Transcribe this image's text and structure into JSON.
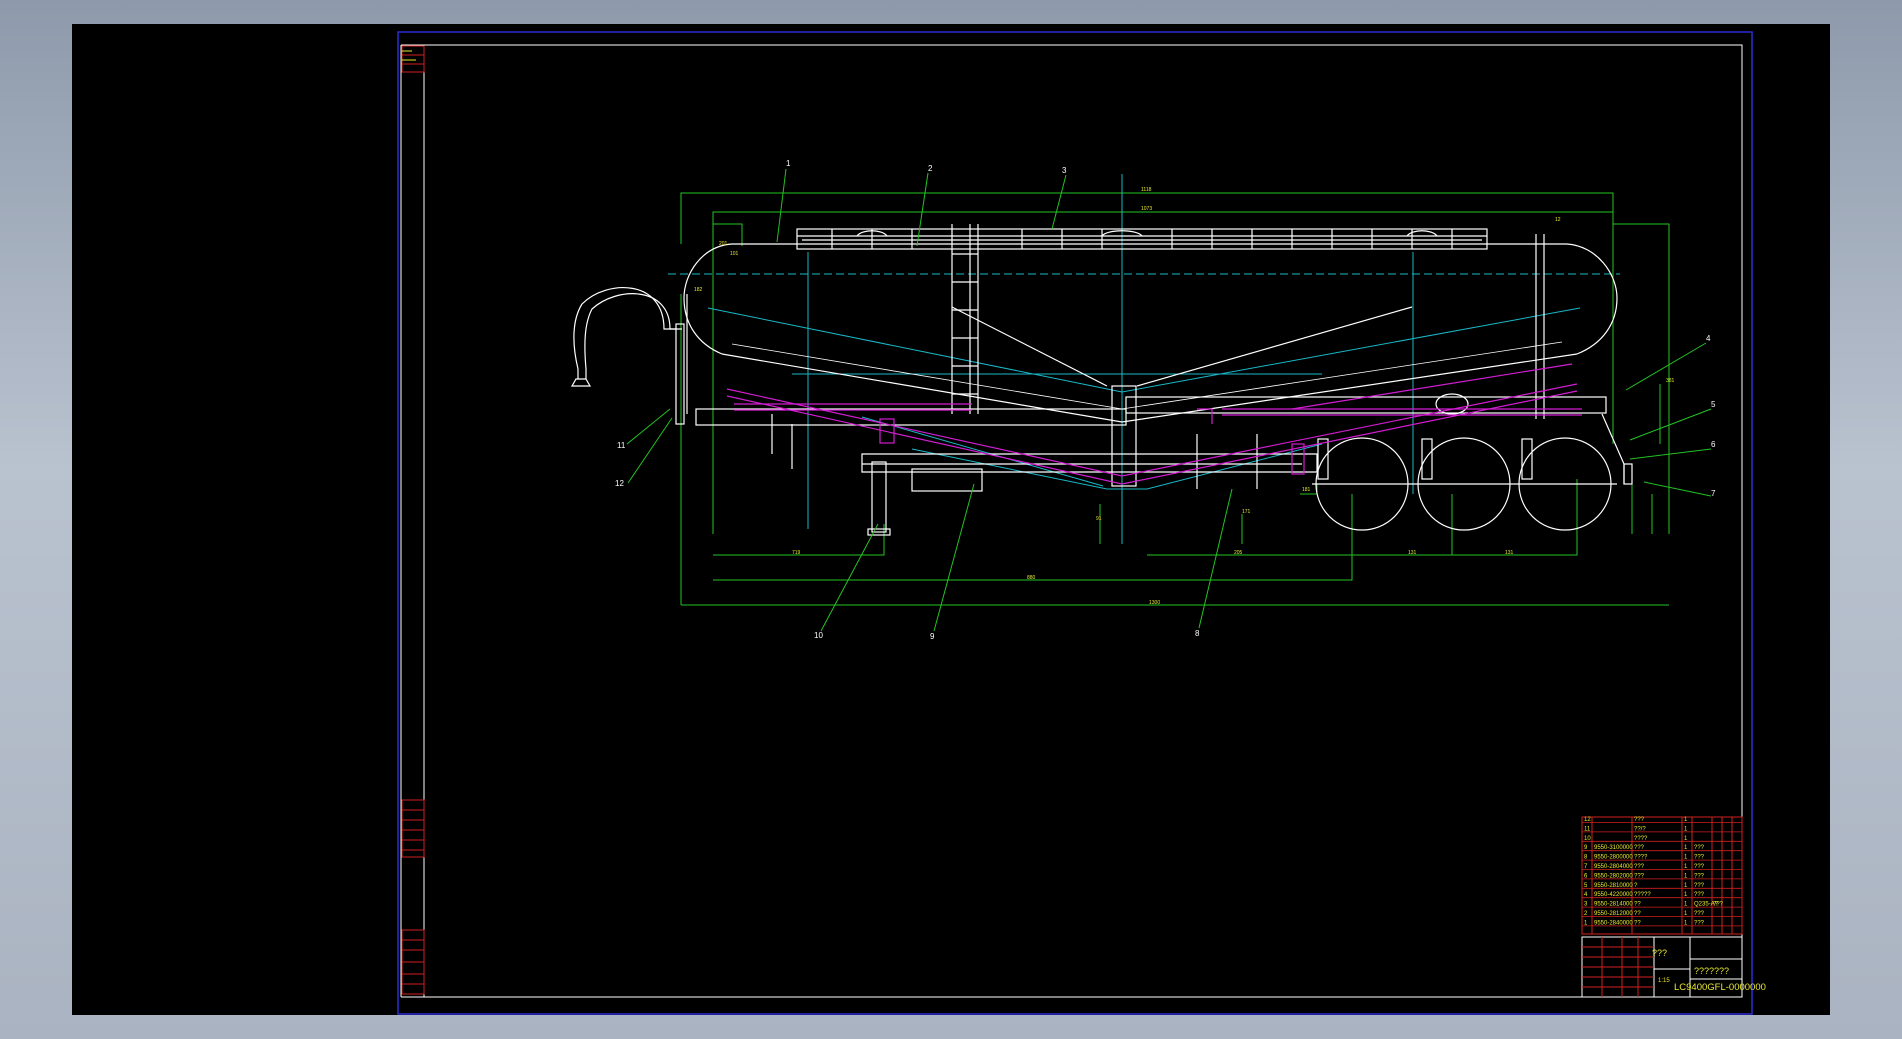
{
  "drawing": {
    "part_callouts": [
      "1",
      "2",
      "3",
      "4",
      "5",
      "6",
      "7",
      "8",
      "9",
      "10",
      "11",
      "12"
    ],
    "dimensions": {
      "top_overall": "1118",
      "tank_length": "1073",
      "top_right_small": "12",
      "left_small_a": "201",
      "left_small_b": "101",
      "left_height": "182",
      "right_height": "381",
      "bottom_1": "719",
      "bottom_2": "880",
      "bottom_3": "1300",
      "bottom_r1": "205",
      "bottom_r2": "131",
      "bottom_r3": "131",
      "axle_height": "91",
      "rear_height": "171",
      "rear_small": "181"
    },
    "bom": {
      "rows": [
        {
          "no": "12",
          "code": "",
          "name": "???",
          "qty": "1",
          "material": "",
          "note": ""
        },
        {
          "no": "11",
          "code": "",
          "name": "??/?",
          "qty": "1",
          "material": "",
          "note": ""
        },
        {
          "no": "10",
          "code": "",
          "name": "????",
          "qty": "1",
          "material": "",
          "note": ""
        },
        {
          "no": "9",
          "code": "9550-3100000",
          "name": "???",
          "qty": "1",
          "material": "???",
          "note": ""
        },
        {
          "no": "8",
          "code": "9550-2800000",
          "name": "????",
          "qty": "1",
          "material": "???",
          "note": ""
        },
        {
          "no": "7",
          "code": "9550-2804000",
          "name": "???",
          "qty": "1",
          "material": "???",
          "note": ""
        },
        {
          "no": "6",
          "code": "9550-2802000",
          "name": "???",
          "qty": "1",
          "material": "???",
          "note": ""
        },
        {
          "no": "5",
          "code": "9550-2810000",
          "name": "?",
          "qty": "1",
          "material": "???",
          "note": ""
        },
        {
          "no": "4",
          "code": "9550-4220000",
          "name": "?????",
          "qty": "1",
          "material": "???",
          "note": ""
        },
        {
          "no": "3",
          "code": "9550-2814000",
          "name": "??",
          "qty": "1",
          "material": "Q235-A?",
          "note": "???"
        },
        {
          "no": "2",
          "code": "9550-2812000",
          "name": "??",
          "qty": "1",
          "material": "???",
          "note": ""
        },
        {
          "no": "1",
          "code": "9550-2840000",
          "name": "??",
          "qty": "1",
          "material": "???",
          "note": ""
        }
      ]
    },
    "title_block": {
      "name": "???",
      "company": "???????",
      "scale": "1:15",
      "drawing_number": "LC9400GFL-0000000"
    }
  },
  "colors": {
    "background": "#000000",
    "frame": "#ffffff",
    "outer_frame": "#2b2bd6",
    "dimension": "#22c322",
    "centerline": "#18b8c8",
    "piping": "#d21dd2",
    "part": "#ffffff",
    "title_block": "#d02020",
    "text_yellow": "#e8e830"
  }
}
